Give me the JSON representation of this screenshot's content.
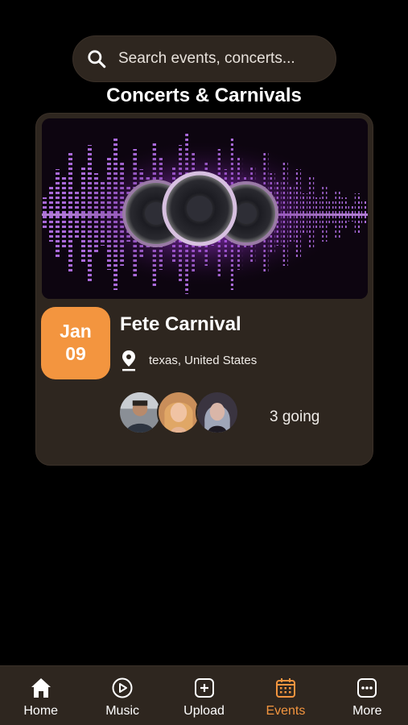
{
  "search": {
    "placeholder": "Search events, concerts..."
  },
  "section": {
    "title": "Concerts & Carnivals"
  },
  "event": {
    "month": "Jan",
    "day": "09",
    "title": "Fete Carnival",
    "location": "texas, United States",
    "attendees": [
      "avatar-1",
      "avatar-2",
      "avatar-3"
    ],
    "going_label": "3 going"
  },
  "nav": {
    "items": [
      {
        "label": "Home",
        "icon": "home-icon"
      },
      {
        "label": "Music",
        "icon": "play-circle-icon"
      },
      {
        "label": "Upload",
        "icon": "plus-square-icon"
      },
      {
        "label": "Events",
        "icon": "calendar-icon",
        "active": true
      },
      {
        "label": "More",
        "icon": "more-icon"
      }
    ]
  },
  "colors": {
    "accent": "#f3953f",
    "surface": "#2e261f",
    "background": "#000000"
  }
}
